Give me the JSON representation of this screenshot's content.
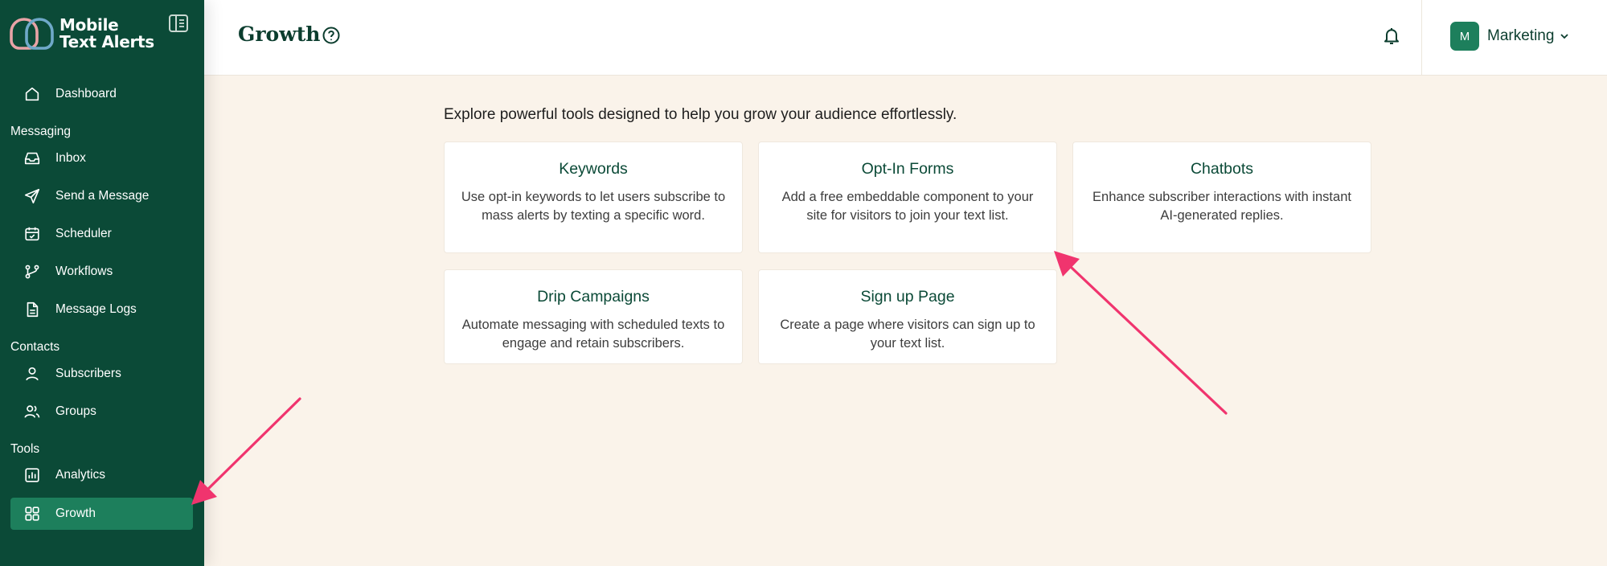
{
  "brand": {
    "line1": "Mobile",
    "line2": "Text Alerts"
  },
  "sidebar": {
    "top_items": [
      {
        "label": "Dashboard",
        "icon": "home-icon"
      }
    ],
    "sections": [
      {
        "label": "Messaging",
        "items": [
          {
            "label": "Inbox",
            "icon": "inbox-icon"
          },
          {
            "label": "Send a Message",
            "icon": "send-icon"
          },
          {
            "label": "Scheduler",
            "icon": "calendar-icon"
          },
          {
            "label": "Workflows",
            "icon": "workflow-icon"
          },
          {
            "label": "Message Logs",
            "icon": "document-icon"
          }
        ]
      },
      {
        "label": "Contacts",
        "items": [
          {
            "label": "Subscribers",
            "icon": "user-icon"
          },
          {
            "label": "Groups",
            "icon": "users-icon"
          }
        ]
      },
      {
        "label": "Tools",
        "items": [
          {
            "label": "Analytics",
            "icon": "bar-chart-icon"
          },
          {
            "label": "Growth",
            "icon": "grid-icon",
            "active": true
          }
        ]
      }
    ]
  },
  "header": {
    "title": "Growth",
    "account": {
      "avatar_initial": "M",
      "name": "Marketing"
    }
  },
  "main": {
    "intro": "Explore powerful tools designed to help you grow your audience effortlessly.",
    "cards": [
      {
        "title": "Keywords",
        "description": "Use opt-in keywords to let users subscribe to mass alerts by texting a specific word."
      },
      {
        "title": "Opt-In Forms",
        "description": "Add a free embeddable component to your site for visitors to join your text list."
      },
      {
        "title": "Chatbots",
        "description": "Enhance subscriber interactions with instant AI-generated replies."
      },
      {
        "title": "Drip Campaigns",
        "description": "Automate messaging with scheduled texts to engage and retain subscribers."
      },
      {
        "title": "Sign up Page",
        "description": "Create a page where visitors can sign up to your text list."
      }
    ]
  },
  "colors": {
    "sidebar_bg": "#0b4a37",
    "active_item_bg": "#1d7f5c",
    "page_bg": "#faf3ea",
    "accent_text": "#0b4a37",
    "annotation_arrow": "#f0346e"
  }
}
